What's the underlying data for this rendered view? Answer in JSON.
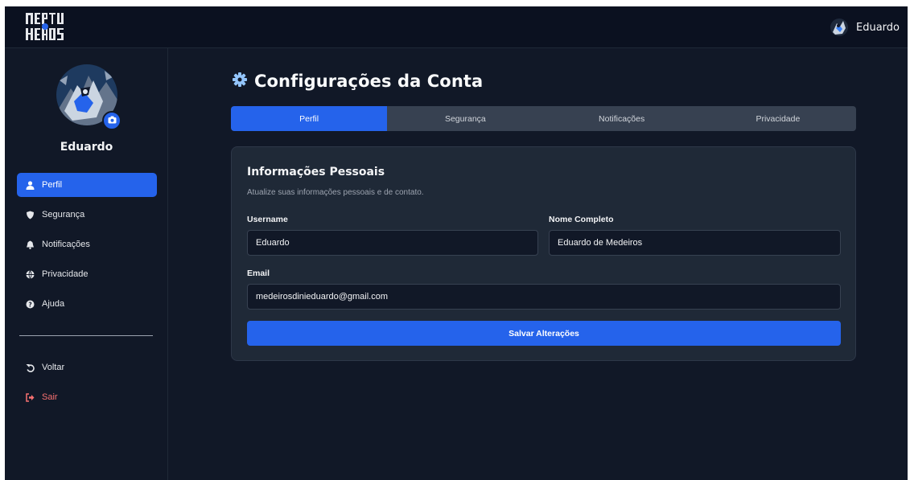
{
  "header": {
    "logo_text": "NEPTUNE HEROES",
    "user_name": "Eduardo"
  },
  "sidebar": {
    "profile_name": "Eduardo",
    "items": [
      {
        "label": "Perfil",
        "icon": "user-icon",
        "active": true
      },
      {
        "label": "Segurança",
        "icon": "shield-icon",
        "active": false
      },
      {
        "label": "Notificações",
        "icon": "bell-icon",
        "active": false
      },
      {
        "label": "Privacidade",
        "icon": "globe-icon",
        "active": false
      },
      {
        "label": "Ajuda",
        "icon": "question-circle-icon",
        "active": false
      }
    ],
    "bottom_items": [
      {
        "label": "Voltar",
        "icon": "undo-icon"
      },
      {
        "label": "Sair",
        "icon": "sign-out-icon"
      }
    ]
  },
  "main": {
    "title": "Configurações da Conta",
    "tabs": [
      {
        "label": "Perfil",
        "active": true
      },
      {
        "label": "Segurança",
        "active": false
      },
      {
        "label": "Notificações",
        "active": false
      },
      {
        "label": "Privacidade",
        "active": false
      }
    ],
    "card": {
      "title": "Informações Pessoais",
      "subtitle": "Atualize suas informações pessoais e de contato.",
      "fields": {
        "username": {
          "label": "Username",
          "value": "Eduardo"
        },
        "full_name": {
          "label": "Nome Completo",
          "value": "Eduardo de Medeiros"
        },
        "email": {
          "label": "Email",
          "value": "medeirosdinieduardo@gmail.com"
        }
      },
      "save_label": "Salvar Alterações"
    }
  },
  "colors": {
    "accent": "#2563eb",
    "background": "#111827",
    "card": "#1f2937",
    "danger": "#f87171"
  }
}
